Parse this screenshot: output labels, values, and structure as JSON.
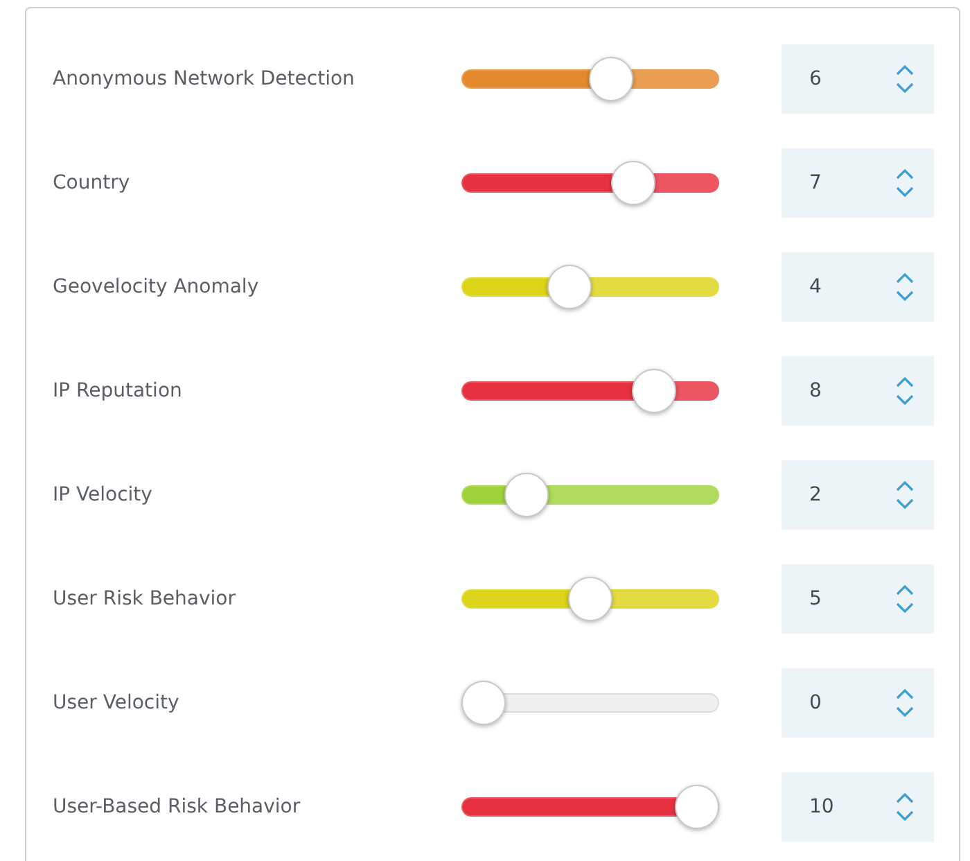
{
  "rules": [
    {
      "label": "Anonymous Network Detection",
      "level": 0.6,
      "color": "#e5892e",
      "value": "6"
    },
    {
      "label": "Country",
      "level": 0.7,
      "color": "#e8313f",
      "value": "7"
    },
    {
      "label": "Geovelocity Anomaly",
      "level": 0.4,
      "color": "#dcd418",
      "value": "4"
    },
    {
      "label": "IP Reputation",
      "level": 0.8,
      "color": "#e8313f",
      "value": "8"
    },
    {
      "label": "IP Velocity",
      "level": 0.2,
      "color": "#9fd23a",
      "value": "2"
    },
    {
      "label": "User Risk Behavior",
      "level": 0.5,
      "color": "#dcd418",
      "value": "5"
    },
    {
      "label": "User Velocity",
      "level": 0,
      "value": "0"
    },
    {
      "label": "User-Based Risk Behavior",
      "level": 1,
      "color": "#e8313f",
      "value": "10"
    }
  ]
}
